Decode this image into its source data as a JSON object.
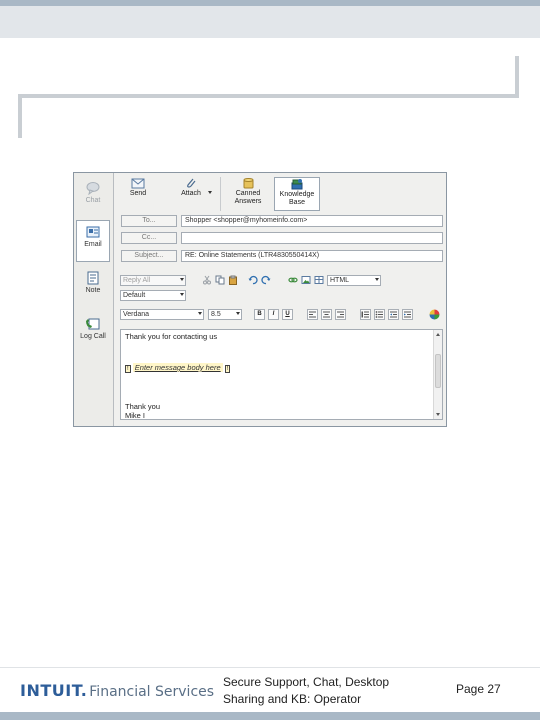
{
  "nav": [
    {
      "label": "Chat",
      "state": "disabled",
      "icon": "chat-bubble-icon"
    },
    {
      "label": "Email",
      "state": "active",
      "icon": "email-icon"
    },
    {
      "label": "Note",
      "state": "normal",
      "icon": "note-icon"
    },
    {
      "label": "Log Call",
      "state": "normal",
      "icon": "log-call-icon"
    }
  ],
  "toolbar": {
    "send": "Send",
    "attach": "Attach",
    "canned": "Canned Answers",
    "kb": "Knowledge Base"
  },
  "fields": {
    "to_label": "To...",
    "cc_label": "Cc...",
    "subject_label": "Subject...",
    "to_value": "Shopper <shopper@myhomeinfo.com>",
    "cc_value": "",
    "subject_value": "RE: Online Statements (LTR4830550414X)"
  },
  "compose": {
    "reply_all": "Reply All",
    "template": "Default",
    "format": "HTML",
    "font": "Verdana",
    "size": "8.5"
  },
  "format_buttons": [
    "B",
    "I",
    "U"
  ],
  "body": {
    "greeting": "Thank you for contacting us",
    "marker": "!",
    "placeholder": "Enter message body here",
    "closing": "Thank you",
    "signature": "Mike I"
  },
  "footer": {
    "logo_brand": "INTUIT.",
    "logo_text": "Financial Services",
    "title": "Secure Support, Chat, Desktop Sharing and KB: Operator",
    "page": "Page 27"
  },
  "colors": {
    "brand_blue": "#2d5d99",
    "band": "#a9b8c6",
    "placeholder_highlight": "#fff6c8"
  }
}
